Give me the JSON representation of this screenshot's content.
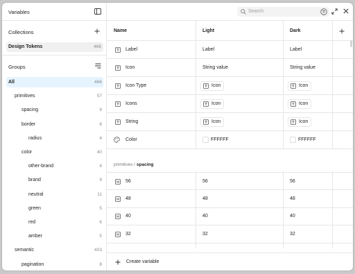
{
  "sidebar": {
    "title": "Variables",
    "collections_label": "Collections",
    "collection": {
      "name": "Design Tokens",
      "count": "466"
    },
    "groups_label": "Groups",
    "groups": [
      {
        "label": "All",
        "count": "466",
        "indent": 0,
        "selected": true
      },
      {
        "label": "primitives",
        "count": "57",
        "indent": 1
      },
      {
        "label": "spacing",
        "count": "9",
        "indent": 2
      },
      {
        "label": "border",
        "count": "8",
        "indent": 2
      },
      {
        "label": "radius",
        "count": "4",
        "indent": 3
      },
      {
        "label": "color",
        "count": "40",
        "indent": 2
      },
      {
        "label": "other-brand",
        "count": "4",
        "indent": 3
      },
      {
        "label": "brand",
        "count": "9",
        "indent": 3
      },
      {
        "label": "neutral",
        "count": "11",
        "indent": 3
      },
      {
        "label": "green",
        "count": "5",
        "indent": 3
      },
      {
        "label": "red",
        "count": "6",
        "indent": 3
      },
      {
        "label": "amber",
        "count": "5",
        "indent": 3
      },
      {
        "label": "semantic",
        "count": "403",
        "indent": 1
      },
      {
        "label": "pagination",
        "count": "8",
        "indent": 2
      }
    ]
  },
  "search": {
    "placeholder": "Search"
  },
  "table": {
    "headers": {
      "name": "Name",
      "light": "Light",
      "dark": "Dark"
    },
    "rows": [
      {
        "name": "Label",
        "icon": "text-icon",
        "light": "Label",
        "dark": "Label",
        "kind": "text"
      },
      {
        "name": "Icon",
        "icon": "text-icon",
        "light": "String value",
        "dark": "String value",
        "kind": "text"
      },
      {
        "name": "Icon Type",
        "icon": "text-icon",
        "light": "Icon",
        "dark": "Icon",
        "kind": "chip"
      },
      {
        "name": "Icons",
        "icon": "text-icon",
        "light": "Icon",
        "dark": "Icon",
        "kind": "chip"
      },
      {
        "name": "String",
        "icon": "text-icon",
        "light": "Icon",
        "dark": "Icon",
        "kind": "chip"
      },
      {
        "name": "Color",
        "icon": "palette-icon",
        "light": "FFFFFF",
        "dark": "FFFFFF",
        "kind": "color"
      }
    ],
    "group": {
      "prefix": "primitives / ",
      "name": "spacing"
    },
    "group_rows": [
      {
        "name": "56",
        "light": "56",
        "dark": "56"
      },
      {
        "name": "48",
        "light": "48",
        "dark": "48"
      },
      {
        "name": "40",
        "light": "40",
        "dark": "40"
      },
      {
        "name": "32",
        "light": "32",
        "dark": "32"
      }
    ]
  },
  "footer": {
    "create_label": "Create variable"
  },
  "colors": {
    "accent_selected": "#e5f4ff",
    "border": "#e6e6e6",
    "muted": "#8a8a8a"
  }
}
